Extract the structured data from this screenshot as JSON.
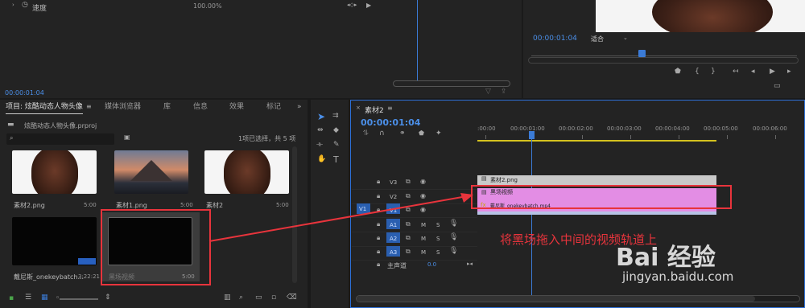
{
  "effects": {
    "speed_label": "速度",
    "speed_value": "100.00%",
    "timecode": "00:00:01:04"
  },
  "program": {
    "timecode": "00:00:01:04",
    "fit": "适合"
  },
  "project": {
    "tabs": [
      "项目: 炫酷动态人物头像",
      "媒体浏览器",
      "库",
      "信息",
      "效果",
      "标记"
    ],
    "file": "炫酷动态人物头像.prproj",
    "selection": "1项已选择，共 5 项",
    "search_placeholder": "",
    "items": [
      {
        "name": "素材2.png",
        "duration": "5:00"
      },
      {
        "name": "素材1.png",
        "duration": "5:00"
      },
      {
        "name": "素材2",
        "duration": "5:00"
      },
      {
        "name": "戴尼斯_onekeybatch...",
        "duration": "3:22:21"
      },
      {
        "name": "黑场视频",
        "duration": "5:00"
      }
    ]
  },
  "timeline": {
    "tab": "素材2",
    "timecode": "00:00:01:04",
    "ruler": [
      ":00:00",
      "00:00:01:00",
      "00:00:02:00",
      "00:00:03:00",
      "00:00:04:00",
      "00:00:05:00",
      "00:00:06:00"
    ],
    "tracks": {
      "v3": "V3",
      "v2": "V2",
      "v1": "V1",
      "v1_src": "V1",
      "a1": "A1",
      "a2": "A2",
      "a3": "A3",
      "m": "M",
      "s": "S",
      "master": "主声道",
      "master_value": "0.0"
    },
    "clips": {
      "v3": "素材2.png",
      "v2": "黑场视频",
      "v1": "戴尼斯_onekeybatch.mp4"
    }
  },
  "annotation": "将黑场拖入中间的视频轨道上",
  "watermark": {
    "brand": "Bai 经验",
    "url": "jingyan.baidu.com"
  },
  "colors": {
    "accent": "#4b8fe8",
    "clip_pink": "#e38de4",
    "clip_gray": "#c9c9c9",
    "red": "#e8343c"
  }
}
